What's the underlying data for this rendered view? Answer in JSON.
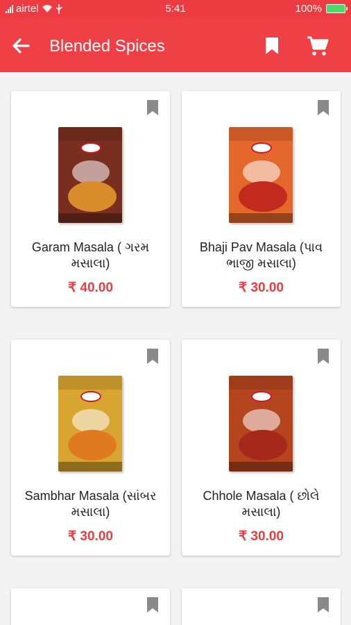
{
  "status": {
    "carrier": "airtel",
    "time": "5:41",
    "battery": "100%"
  },
  "app_bar": {
    "title": "Blended Spices"
  },
  "products": [
    {
      "name": "Garam Masala ( ગરમ મસાલા)",
      "price": "₹ 40.00",
      "box_color": "#7a2e1f",
      "bowl_color": "#d98c2a"
    },
    {
      "name": "Bhaji Pav Masala (પાવ ભાજી મસાલા)",
      "price": "₹ 30.00",
      "box_color": "#e4682b",
      "bowl_color": "#c22a1e"
    },
    {
      "name": "Sambhar Masala (સાંબર મસાલા)",
      "price": "₹ 30.00",
      "box_color": "#d9a531",
      "bowl_color": "#e07a21"
    },
    {
      "name": "Chhole Masala ( છોલે મસાલા)",
      "price": "₹ 30.00",
      "box_color": "#b5451f",
      "bowl_color": "#a6281b"
    }
  ],
  "colors": {
    "accent": "#ef4046",
    "price": "#ef3b41"
  }
}
